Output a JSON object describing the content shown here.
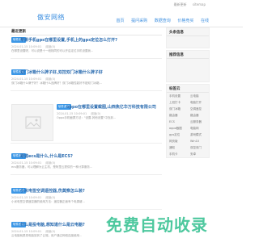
{
  "topbar": {
    "link1": "最新更新",
    "link2": "sitemap"
  },
  "header": {
    "logo": "傲安网络",
    "nav": [
      "首页",
      "提问采购",
      "数据查询",
      "价格竞买",
      "在线"
    ]
  },
  "main": {
    "section_title": "最近更新",
    "articles": [
      {
        "tag": "软件资讯",
        "title": "苹果手机gps在哪里设置,手机上的gps定位怎么打开?",
        "date": "2024-01-15 10:09:01",
        "views": "阅读(0)",
        "excerpt": "在哪里设置呢，可以说是十一段相同的可以开启定位手机设置我..."
      },
      {
        "tag": "软件资讯",
        "title": "双门冰箱什么牌子好,双控双门冰箱什么牌子好",
        "date": "2024-01-15 10:09:01",
        "views": "阅读(0)",
        "excerpt": "双门冰箱什么牌子好？冰箱什么品牌好？双门冰箱性能好不错双门冰箱..."
      },
      {
        "tag": "软件资讯",
        "title": "oppo在哪里设置截图,山西焦亿华万科技有限公司",
        "date": "2024-01-15 10:09:01",
        "views": "阅读(0)",
        "excerpt": "Oppo手机截屏方法：\"设置-其他设置\"中找到..."
      },
      {
        "tag": "软件资讯",
        "title": "跟递ecs是什么,什么是ECS?",
        "date": "2024-01-15 10:09:01",
        "views": "阅读(0)",
        "excerpt": "ecs服务器，可以理解为云主机，是阿里云提供的一种计算服务..."
      },
      {
        "tag": "软件资讯",
        "title": "小米电签空调遥控器,伤莫察怎么装?",
        "date": "2024-01-15 10:09:01",
        "views": "阅读(0)",
        "excerpt": "小米电签空调遥控器的使用方法：遥控器正面有个电源键..."
      },
      {
        "tag": "软件资讯",
        "title": "什么是投电脑,想知道什么是云电脑?",
        "date": "2024-01-15 10:09:01",
        "views": "阅读(0)",
        "excerpt": "云电脑就是把电脑放到了云端，用户通过网络连接使用..."
      }
    ]
  },
  "sidebar": {
    "box1_title": "头条信息",
    "box2_title": "推荐信息",
    "box3_title": "标签云",
    "tags": [
      [
        "手机设置",
        "云电脑"
      ],
      [
        "上班打卡",
        "电脑打开"
      ],
      [
        "双门冰箱",
        "空调遥控"
      ],
      [
        "路由器",
        "路由器"
      ],
      [
        "ECS",
        "云服务器"
      ],
      [
        "oppo截图",
        "电脑网"
      ],
      [
        "gps定位",
        "游戏模式"
      ],
      [
        "网页版",
        "Win10"
      ],
      [
        "通知",
        "双控双门"
      ],
      [
        "手机卡",
        "安卓"
      ]
    ]
  },
  "watermark": "免费自动收录"
}
